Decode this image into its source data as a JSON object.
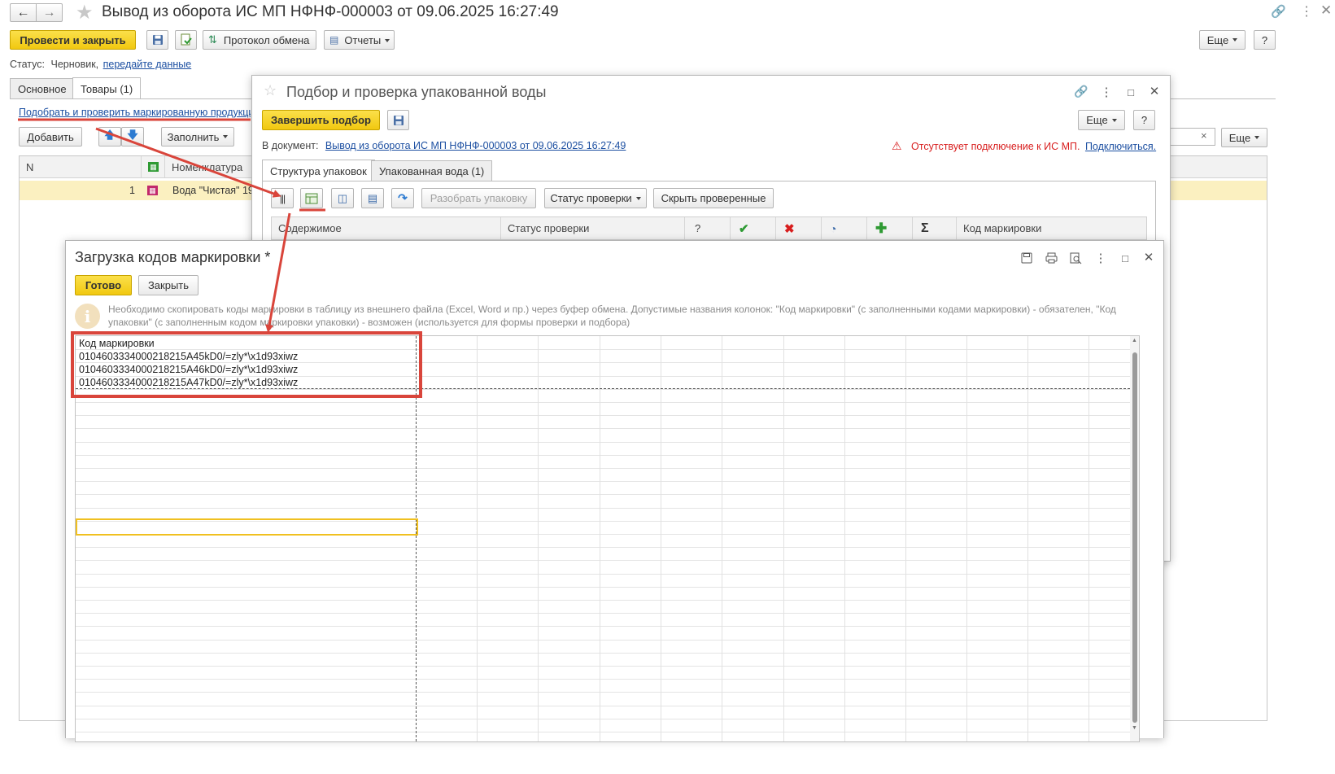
{
  "main_window": {
    "title": "Вывод из оборота ИС МП НФНФ-000003 от 09.06.2025 16:27:49",
    "toolbar": {
      "post_and_close": "Провести и закрыть",
      "exchange_protocol": "Протокол обмена",
      "reports": "Отчеты",
      "more": "Еще",
      "help": "?"
    },
    "status_label": "Статус:",
    "status_value": "Черновик,",
    "status_link": "передайте данные",
    "tabs": [
      "Основное",
      "Товары (1)"
    ],
    "pick_link": "Подобрать и проверить маркированную продукцию",
    "goods_toolbar": {
      "add": "Добавить",
      "fill": "Заполнить",
      "more": "Еще",
      "clear": "×"
    },
    "table": {
      "columns": [
        "N",
        "Номенклатура"
      ],
      "rows": [
        {
          "n": "1",
          "name": "Вода \"Чистая\" 19"
        }
      ]
    }
  },
  "pick_window": {
    "title": "Подбор и проверка упакованной воды",
    "finish_button": "Завершить подбор",
    "more": "Еще",
    "help": "?",
    "doc_label": "В документ:",
    "doc_link": "Вывод из оборота ИС МП НФНФ-000003 от 09.06.2025 16:27:49",
    "warning_text": "Отсутствует подключение к ИС МП.",
    "connect_link": "Подключиться.",
    "tabs": [
      "Структура упаковок",
      "Упакованная вода (1)"
    ],
    "buttons": {
      "unpack": "Разобрать упаковку",
      "check_status": "Статус проверки",
      "hide_checked": "Скрыть проверенные"
    },
    "table_columns": [
      "Содержимое",
      "Статус проверки",
      "?",
      "",
      "",
      "",
      "",
      "",
      "Код маркировки"
    ]
  },
  "load_window": {
    "title": "Загрузка кодов маркировки *",
    "ready_button": "Готово",
    "close_button": "Закрыть",
    "info_text_line1": "Необходимо скопировать коды маркировки в таблицу из внешнего файла (Excel, Word и пр.) через буфер обмена. Допустимые названия колонок: \"Код маркировки\" (с заполненными кодами маркировки) - обязателен, \"Код",
    "info_text_line2": "упаковки\" (с заполненным кодом маркировки упаковки) - возможен (используется для формы проверки и подбора)",
    "sheet": {
      "header": "Код маркировки",
      "codes": [
        "010460333400021821​5A45kD0/=zly*\\x1d93xiwz",
        "010460333400021821​5A46kD0/=zly*\\x1d93xiwz",
        "010460333400021821​5A47kD0/=zly*\\x1d93xiwz"
      ]
    }
  },
  "colors": {
    "accent_yellow": "#f3cc17",
    "annotation_red": "#d9453b",
    "link_blue": "#1c4fa1",
    "warning_red": "#d81e1e"
  }
}
